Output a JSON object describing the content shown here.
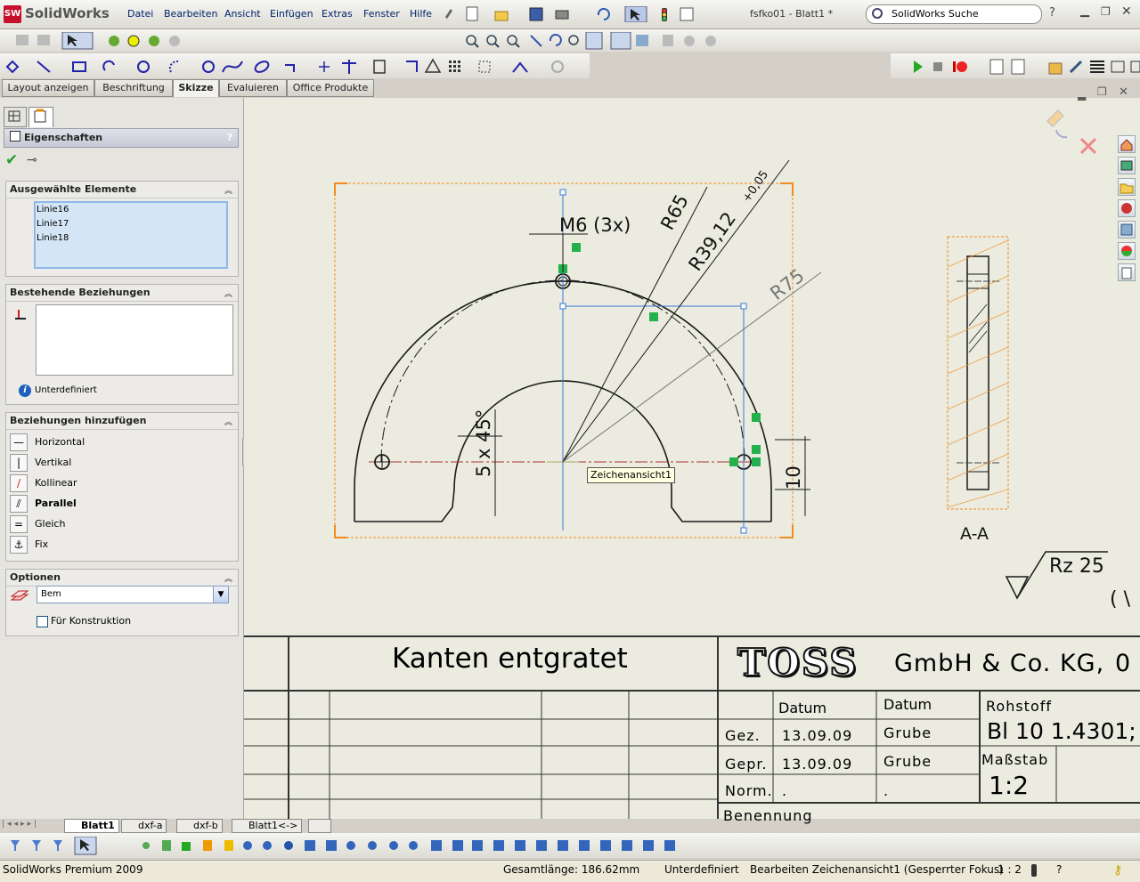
{
  "app": {
    "name": "SolidWorks",
    "logo_text": "SolidWorks",
    "doc_title": "fsfko01 - Blatt1 *"
  },
  "menu": [
    "Datei",
    "Bearbeiten",
    "Ansicht",
    "Einfügen",
    "Extras",
    "Fenster",
    "Hilfe"
  ],
  "search": {
    "placeholder": "SolidWorks Suche"
  },
  "command_tabs": [
    {
      "label": "Layout anzeigen",
      "active": false
    },
    {
      "label": "Beschriftung",
      "active": false
    },
    {
      "label": "Skizze",
      "active": true
    },
    {
      "label": "Evaluieren",
      "active": false
    },
    {
      "label": "Office Produkte",
      "active": false
    }
  ],
  "property_manager": {
    "title": "Eigenschaften",
    "help": "?",
    "selected": {
      "header": "Ausgewählte Elemente",
      "items": [
        "Linie16",
        "Linie17",
        "Linie18"
      ]
    },
    "existing": {
      "header": "Bestehende Beziehungen",
      "status": "Unterdefiniert"
    },
    "add": {
      "header": "Beziehungen hinzufügen",
      "items": [
        {
          "label": "Horizontal",
          "icon": "horizontal-icon",
          "glyph": "—"
        },
        {
          "label": "Vertikal",
          "icon": "vertical-icon",
          "glyph": "|"
        },
        {
          "label": "Kollinear",
          "icon": "collinear-icon",
          "glyph": "/"
        },
        {
          "label": "Parallel",
          "icon": "parallel-icon",
          "glyph": "⫽"
        },
        {
          "label": "Gleich",
          "icon": "equal-icon",
          "glyph": "="
        },
        {
          "label": "Fix",
          "icon": "fix-icon",
          "glyph": "⚓"
        }
      ]
    },
    "options": {
      "header": "Optionen",
      "layer_value": "Bem",
      "for_construction": "Für Konstruktion"
    }
  },
  "drawing": {
    "dim_thread": "M6 (3x)",
    "dim_r65": "R65",
    "dim_r39": "R39,12",
    "dim_tol": "+0,05",
    "dim_r75": "R75",
    "dim_chamfer": "5 x 45°",
    "dim_10": "10",
    "view_tooltip": "Zeichenansicht1",
    "section_label": "A-A",
    "surface": "Rz 25",
    "partial": "( \\"
  },
  "title_block": {
    "note": "Kanten entgratet",
    "company_logo": "TOSS",
    "company": "GmbH & Co. KG,",
    "company_cut": "0",
    "datum_h1": "Datum",
    "datum_h2": "Datum",
    "row_gez": "Gez.",
    "row_gez_date": "13.09.09",
    "row_gez_name": "Grube",
    "row_gepr": "Gepr.",
    "row_gepr_date": "13.09.09",
    "row_gepr_name": "Grube",
    "row_norm": "Norm.",
    "row_norm_a": ".",
    "row_norm_b": ".",
    "rohstoff_label": "Rohstoff",
    "rohstoff_value": "Bl  10 1.4301;",
    "massstab_label": "Maßstab",
    "massstab_value": "1:2",
    "benennung": "Benennung"
  },
  "sheet_tabs": [
    {
      "label": "Blatt1",
      "active": true
    },
    {
      "label": "dxf-a",
      "active": false
    },
    {
      "label": "dxf-b",
      "active": false
    },
    {
      "label": "Blatt1<->",
      "active": false
    }
  ],
  "status": {
    "product": "SolidWorks Premium 2009",
    "length": "Gesamtlänge: 186.62mm",
    "state": "Unterdefiniert",
    "mode": "Bearbeiten Zeichenansicht1 (Gesperrter Fokus)",
    "scale": "1 : 2",
    "help": "?"
  },
  "colors": {
    "accent_orange": "#f28c1e",
    "selection_blue": "#3a78d8",
    "relation_green": "#22b14c",
    "brand_red": "#c8102e"
  }
}
